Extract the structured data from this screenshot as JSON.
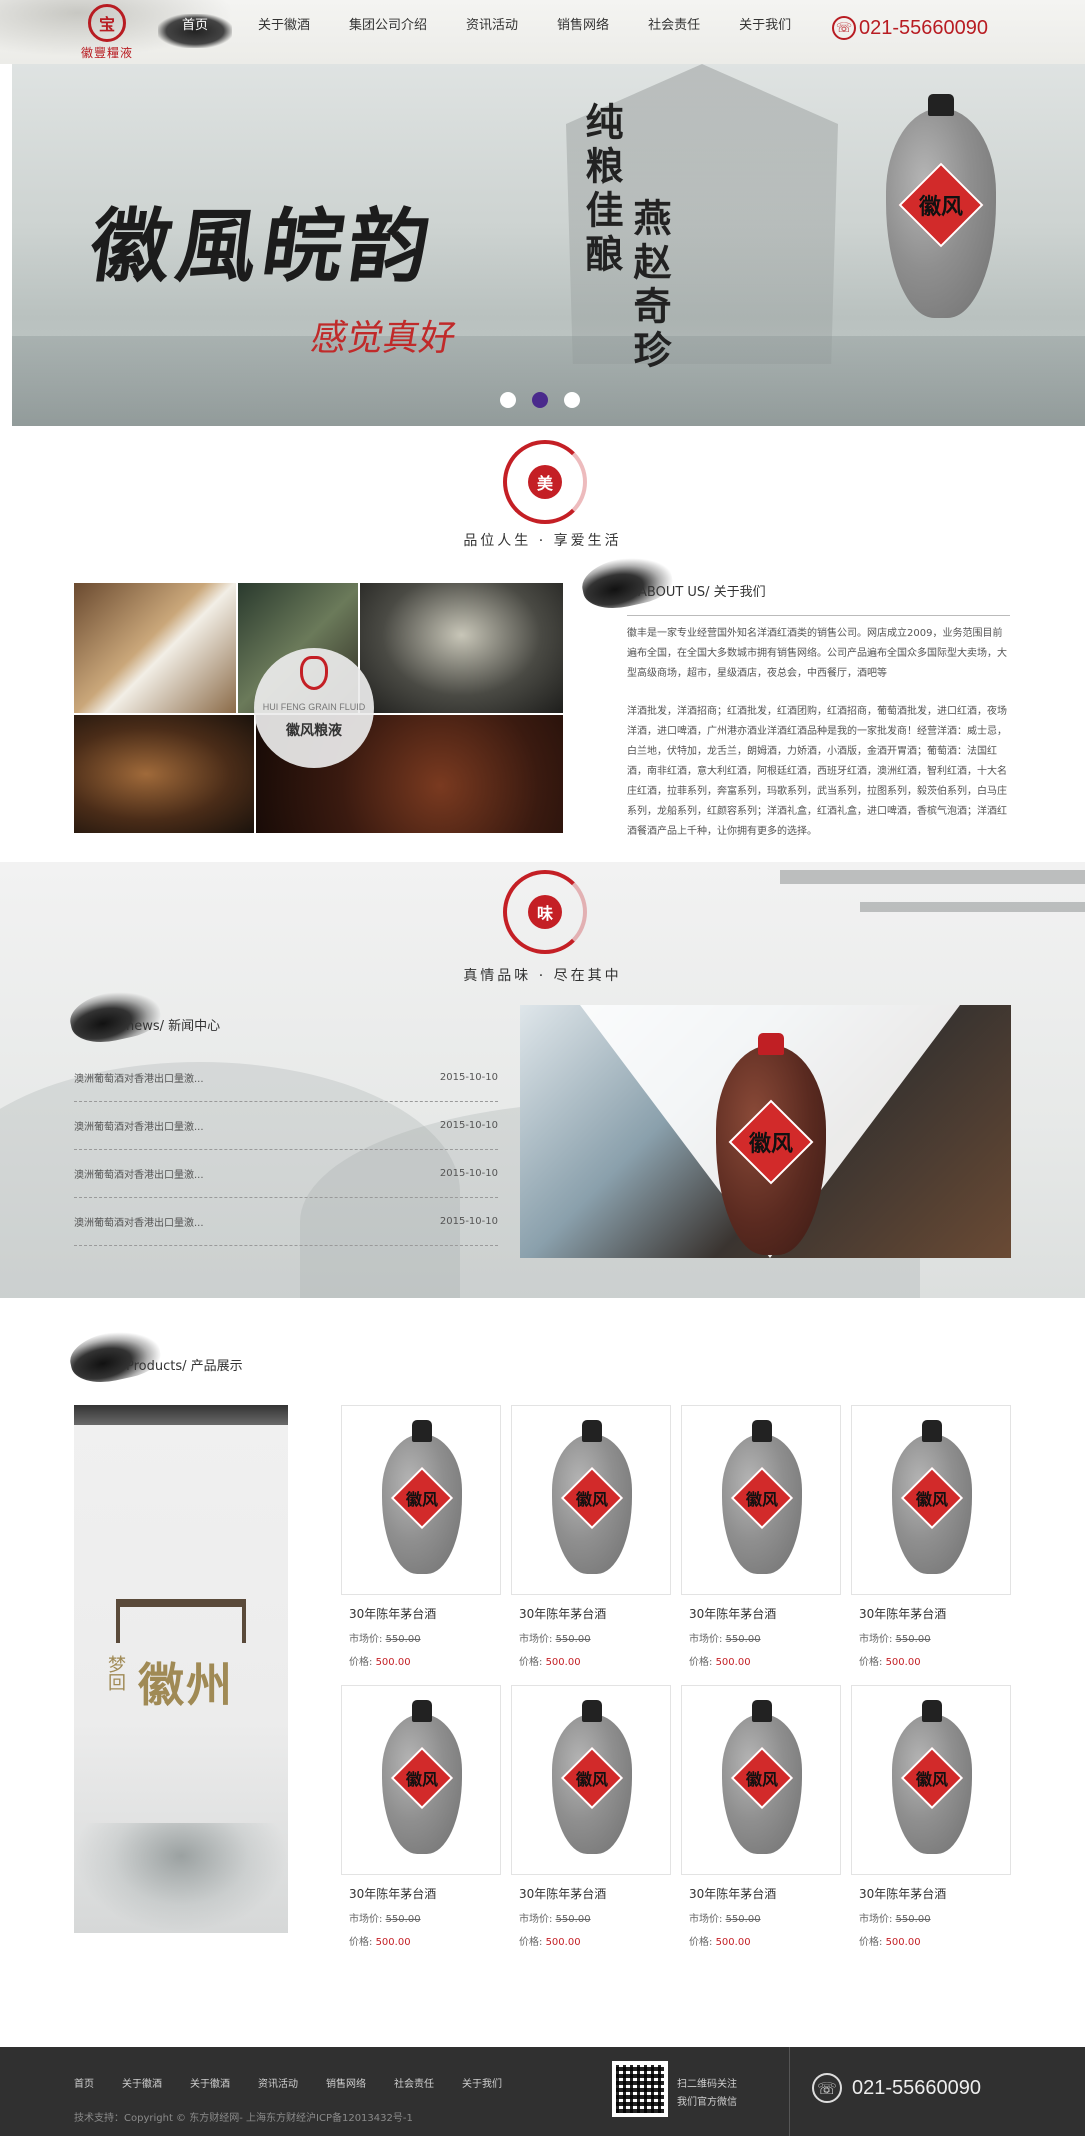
{
  "header": {
    "logo_mark": "宝",
    "logo_text": "徽豐糧液",
    "nav": [
      "首页",
      "关于徽酒",
      "集团公司介绍",
      "资讯活动",
      "销售网络",
      "社会责任",
      "关于我们"
    ],
    "phone_icon": "phone-icon",
    "phone": "021-55660090"
  },
  "banner": {
    "title": "徽風皖韵",
    "subtitle": "感觉真好",
    "vertical_1": "纯粮佳酿",
    "vertical_2": "燕赵奇珍",
    "bottle_label": "徽风",
    "slides": 3,
    "active_slide": 2
  },
  "section1": {
    "seal_char": "美",
    "slogan": "品位人生 · 享爱生活",
    "brand_en": "HUI FENG GRAIN FLUID",
    "brand_cn": "徽风粮液",
    "about_title": "ABOUT US/ 关于我们",
    "about_p1": "徽丰是一家专业经营国外知名洋酒红酒类的销售公司。网店成立2009，业务范围目前遍布全国，在全国大多数城市拥有销售网络。公司产品遍布全国众多国际型大卖场，大型高级商场，超市，星级酒店，夜总会，中西餐厅，酒吧等",
    "about_p2": "洋酒批发，洋酒招商；红酒批发，红酒团购，红酒招商，葡萄酒批发，进口红酒，夜场洋酒，进口啤酒，广州港亦酒业洋酒红酒品种是我的一家批发商！经营洋酒：威士忌，白兰地，伏特加，龙舌兰，朗姆酒，力娇酒，小酒版，金酒开胃酒；葡萄酒：法国红酒，南非红酒，意大利红酒，阿根廷红酒，西班牙红酒，澳洲红酒，智利红酒，十大名庄红酒，拉菲系列，奔富系列，玛歌系列，武当系列，拉图系列，毅茨伯系列，白马庄系列，龙船系列，红颜容系列；洋酒礼盒，红酒礼盒，进口啤酒，香槟气泡酒；洋酒红酒餐酒产品上千种，让你拥有更多的选择。"
  },
  "section2": {
    "seal_char": "味",
    "slogan": "真情品味 · 尽在其中",
    "news_title": "news/ 新闻中心",
    "news": [
      {
        "title": "澳洲葡萄酒对香港出口量激...",
        "date": "2015-10-10"
      },
      {
        "title": "澳洲葡萄酒对香港出口量激...",
        "date": "2015-10-10"
      },
      {
        "title": "澳洲葡萄酒对香港出口量激...",
        "date": "2015-10-10"
      },
      {
        "title": "澳洲葡萄酒对香港出口量激...",
        "date": "2015-10-10"
      }
    ],
    "promo_label": "徽风"
  },
  "products": {
    "title": "Products/ 产品展示",
    "side_small": "梦回",
    "side_text": "徽州",
    "market_label": "市场价:",
    "price_label": "价格:",
    "items": [
      {
        "name": "30年陈年茅台酒",
        "market_price": "550.00",
        "price": "500.00"
      },
      {
        "name": "30年陈年茅台酒",
        "market_price": "550.00",
        "price": "500.00"
      },
      {
        "name": "30年陈年茅台酒",
        "market_price": "550.00",
        "price": "500.00"
      },
      {
        "name": "30年陈年茅台酒",
        "market_price": "550.00",
        "price": "500.00"
      },
      {
        "name": "30年陈年茅台酒",
        "market_price": "550.00",
        "price": "500.00"
      },
      {
        "name": "30年陈年茅台酒",
        "market_price": "550.00",
        "price": "500.00"
      },
      {
        "name": "30年陈年茅台酒",
        "market_price": "550.00",
        "price": "500.00"
      },
      {
        "name": "30年陈年茅台酒",
        "market_price": "550.00",
        "price": "500.00"
      }
    ]
  },
  "footer": {
    "nav": [
      "首页",
      "关于徽酒",
      "关于徽酒",
      "资讯活动",
      "销售网络",
      "社会责任",
      "关于我们"
    ],
    "copyright": "技术支持：Copyright © 东方财经网- 上海东方财经沪ICP备12013432号-1",
    "qr_line1": "扫二维码关注",
    "qr_line2": "我们官方微信",
    "phone_icon": "phone-icon",
    "phone": "021-55660090"
  },
  "colors": {
    "accent": "#c41f25",
    "nav_active": "#2a2a2a",
    "footer_bg": "#303030"
  }
}
